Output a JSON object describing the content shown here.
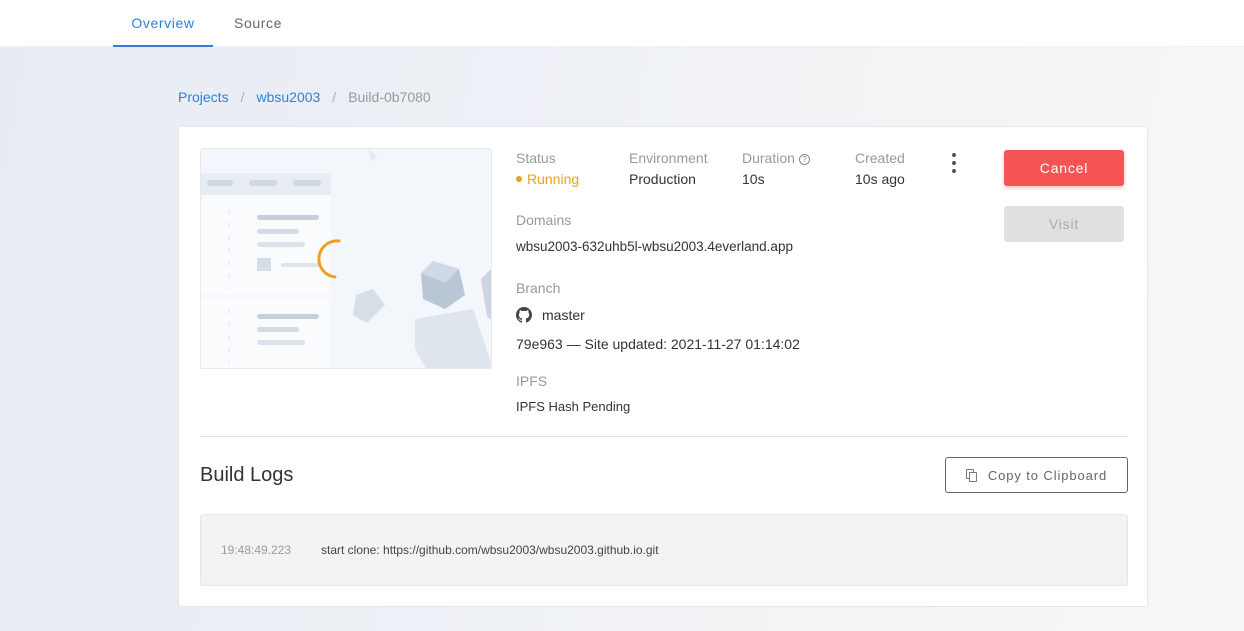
{
  "tabs": [
    {
      "label": "Overview",
      "active": true
    },
    {
      "label": "Source",
      "active": false
    }
  ],
  "breadcrumb": {
    "items": [
      "Projects",
      "wbsu2003"
    ],
    "separator": "/",
    "current": "Build-0b7080"
  },
  "build": {
    "status_label": "Status",
    "status_value": "Running",
    "environment_label": "Environment",
    "environment_value": "Production",
    "duration_label": "Duration",
    "duration_value": "10s",
    "created_label": "Created",
    "created_value": "10s ago",
    "domains_label": "Domains",
    "domain_value": "wbsu2003-632uhb5l-wbsu2003.4everland.app",
    "branch_label": "Branch",
    "branch_value": "master",
    "commit_value": "79e963 — Site updated: 2021-11-27 01:14:02",
    "ipfs_label": "IPFS",
    "ipfs_value": "IPFS Hash Pending"
  },
  "actions": {
    "cancel_label": "Cancel",
    "visit_label": "Visit",
    "copy_label": "Copy to Clipboard"
  },
  "logs": {
    "title": "Build Logs",
    "entries": [
      {
        "time": "19:48:49.223",
        "message": "start clone: https://github.com/wbsu2003/wbsu2003.github.io.git"
      }
    ]
  },
  "colors": {
    "accent": "#2f7fd8",
    "running": "#f0a020",
    "cancel": "#f55354"
  }
}
